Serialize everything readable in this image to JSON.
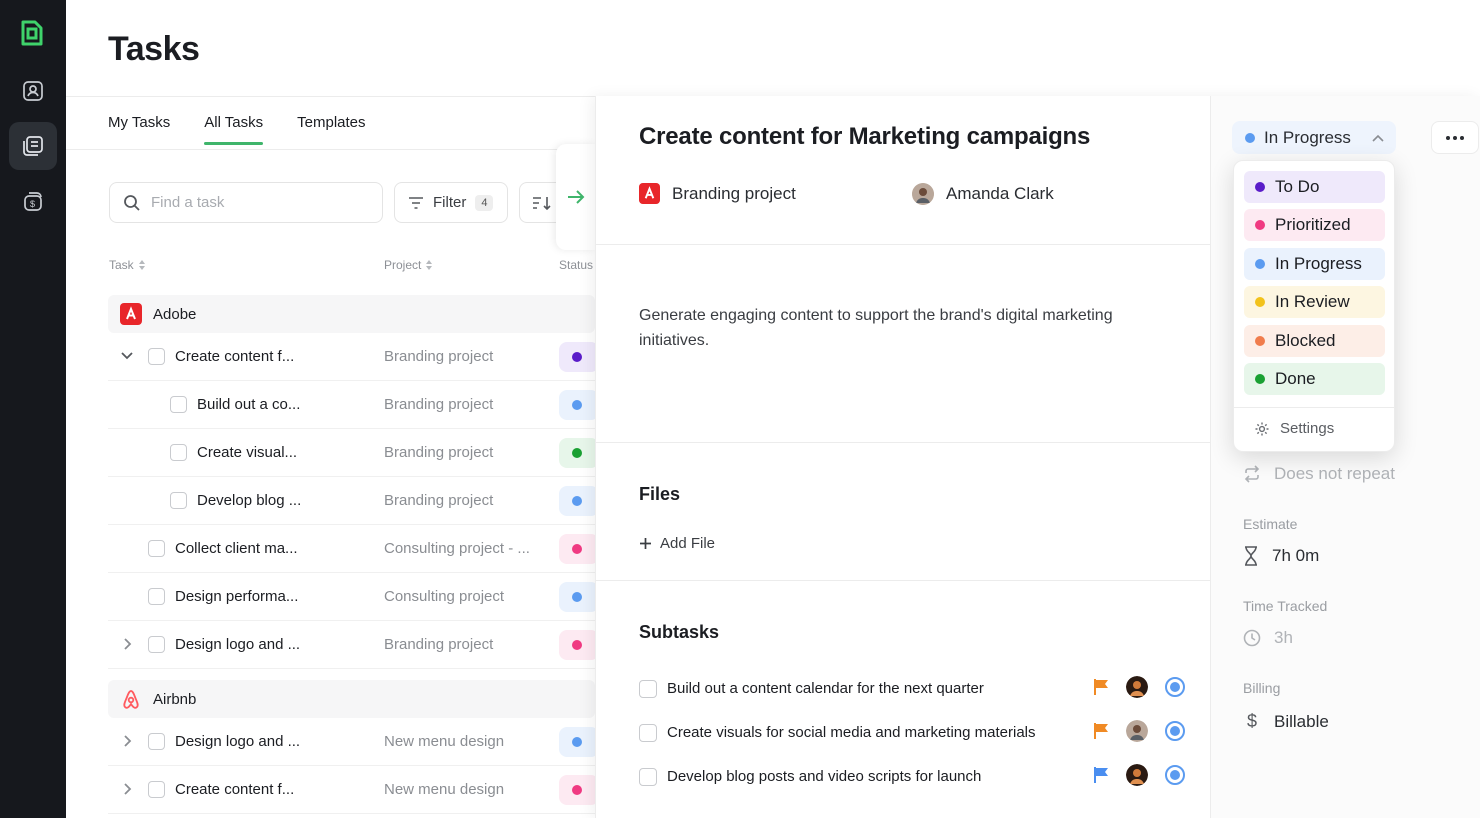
{
  "page": {
    "title": "Tasks"
  },
  "tabs": [
    {
      "label": "My Tasks"
    },
    {
      "label": "All Tasks"
    },
    {
      "label": "Templates"
    }
  ],
  "toolbar": {
    "search_placeholder": "Find a task",
    "filter_label": "Filter",
    "filter_count": "4"
  },
  "columns": {
    "task": "Task",
    "project": "Project",
    "status": "Status"
  },
  "groups": [
    {
      "name": "Adobe",
      "icon": "adobe-logo"
    },
    {
      "name": "Airbnb",
      "icon": "airbnb-logo"
    }
  ],
  "rows": [
    {
      "task": "Create content f...",
      "project": "Branding project",
      "status_color": "#5a1cc9"
    },
    {
      "task": "Build out a co...",
      "project": "Branding project",
      "status_color": "#5b9bf0"
    },
    {
      "task": "Create visual...",
      "project": "Branding project",
      "status_color": "#1aa033"
    },
    {
      "task": "Develop blog ...",
      "project": "Branding project",
      "status_color": "#5b9bf0"
    },
    {
      "task": "Collect client ma...",
      "project": "Consulting project - ...",
      "status_color": "#f03a82"
    },
    {
      "task": "Design performa...",
      "project": "Consulting project",
      "status_color": "#5b9bf0"
    },
    {
      "task": "Design logo and ...",
      "project": "Branding project",
      "status_color": "#f03a82"
    },
    {
      "task": "Design logo and ...",
      "project": "New menu design",
      "status_color": "#5b9bf0"
    },
    {
      "task": "Create content f...",
      "project": "New menu design",
      "status_color": "#f03a82"
    }
  ],
  "detail": {
    "title": "Create content for Marketing campaigns",
    "project": "Branding project",
    "assignee": "Amanda Clark",
    "description": "Generate engaging content to support the brand's digital marketing initiatives.",
    "files_title": "Files",
    "add_file": "Add File",
    "subtasks_title": "Subtasks",
    "subtasks": [
      {
        "text": "Build out a content calendar for the next quarter",
        "flag_color": "#f08a24"
      },
      {
        "text": "Create visuals for social media and marketing materials",
        "flag_color": "#f08a24"
      },
      {
        "text": "Develop blog posts and video scripts for launch",
        "flag_color": "#4a8ef0"
      }
    ]
  },
  "status": {
    "current": "In Progress",
    "current_color": "#5b9bf0",
    "options": [
      {
        "label": "To Do",
        "dot": "#5a1cc9",
        "bg": "#efe9fb"
      },
      {
        "label": "Prioritized",
        "dot": "#f03a82",
        "bg": "#fdeaf2"
      },
      {
        "label": "In Progress",
        "dot": "#5b9bf0",
        "bg": "#eaf2fd"
      },
      {
        "label": "In Review",
        "dot": "#f2c21b",
        "bg": "#fdf6e1"
      },
      {
        "label": "Blocked",
        "dot": "#f07c4c",
        "bg": "#fdeee7"
      },
      {
        "label": "Done",
        "dot": "#1aa033",
        "bg": "#e7f6ea"
      }
    ],
    "settings": "Settings"
  },
  "side": {
    "repeat": "Does not repeat",
    "estimate_label": "Estimate",
    "estimate_value": "7h 0m",
    "tracked_label": "Time Tracked",
    "tracked_value": "3h",
    "billing_label": "Billing",
    "billing_value": "Billable"
  }
}
